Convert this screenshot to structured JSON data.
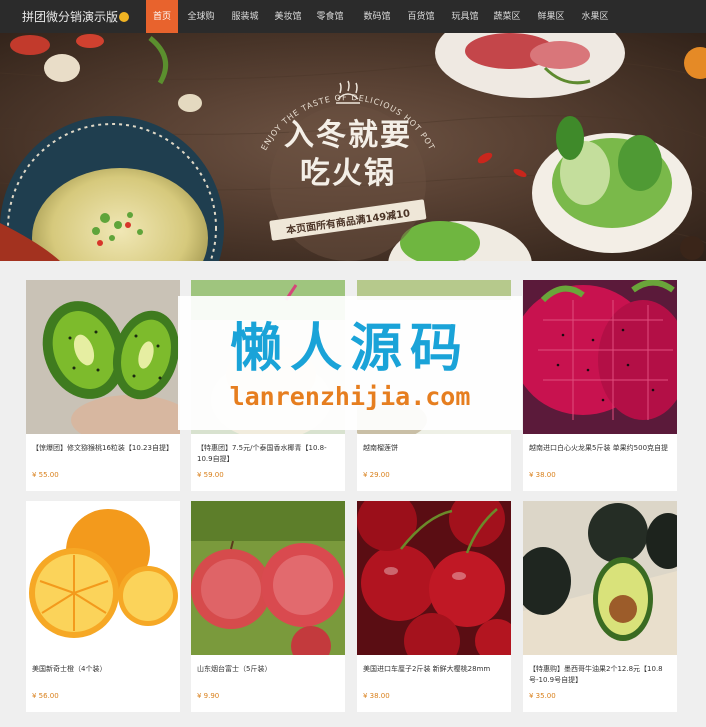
{
  "site": {
    "title": "拼团微分销演示版"
  },
  "nav": {
    "items": [
      "首页",
      "全球购",
      "服装城",
      "美妆馆",
      "零食馆",
      "数码馆",
      "百货馆",
      "玩具馆",
      "蔬菜区",
      "鲜果区",
      "水果区"
    ],
    "active_index": 0,
    "active_color": "#e8632d"
  },
  "banner": {
    "arc_text": "ENJOY THE TASTE OF DELICIOUS HOT POT",
    "headline_1": "入冬就要",
    "headline_2": "吃火锅",
    "promo": "本页面所有商品满149减10",
    "slide_count": 4,
    "active_slide": 1
  },
  "products": [
    {
      "name": "【惊爆团】修文猕猴桃16粒装【10.23自提】",
      "price": "¥ 55.00",
      "image": "kiwi"
    },
    {
      "name": "【特惠团】7.5元/个泰国香水椰青【10.8-10.9自提】",
      "price": "¥ 59.00",
      "image": "coconut"
    },
    {
      "name": "越南榴莲饼",
      "price": "¥ 29.00",
      "image": "durian-cake"
    },
    {
      "name": "越南进口白心火龙果5斤装 单果约500克自提",
      "price": "¥ 38.00",
      "image": "dragon-fruit"
    },
    {
      "name": "美国新奇士橙（4个装）",
      "price": "¥ 56.00",
      "image": "orange"
    },
    {
      "name": "山东烟台富士（5斤装）",
      "price": "¥ 9.90",
      "image": "apple"
    },
    {
      "name": "美国进口车厘子2斤装 新鲜大樱桃28mm",
      "price": "¥ 38.00",
      "image": "cherry"
    },
    {
      "name": "【特惠购】墨西哥牛油果2个12.8元【10.8号-10.9号自提】",
      "price": "¥ 35.00",
      "image": "avocado"
    }
  ],
  "watermark": {
    "cn": "懒人源码",
    "en": "lanrenzhijia.com"
  }
}
